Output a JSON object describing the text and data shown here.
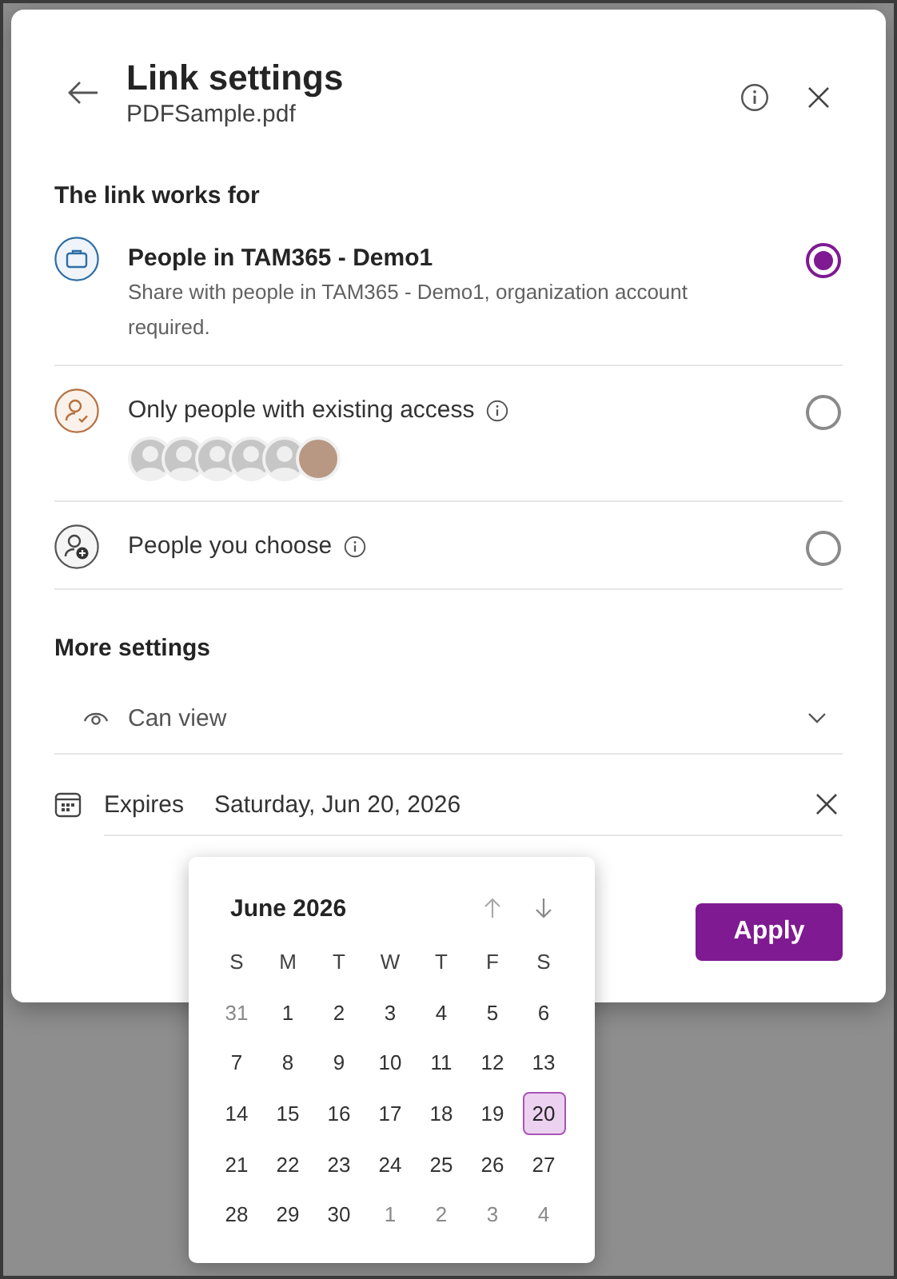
{
  "dialog": {
    "title": "Link settings",
    "file_name": "PDFSample.pdf",
    "section_title": "The link works for",
    "options": [
      {
        "kind": "organization",
        "title": "People in TAM365 - Demo1",
        "description": "Share with people in TAM365 - Demo1, organization account required.",
        "info": false,
        "selected": true
      },
      {
        "kind": "existing",
        "title": "Only people with existing access",
        "info": true,
        "selected": false,
        "avatars": [
          {
            "kind": "placeholder"
          },
          {
            "kind": "placeholder"
          },
          {
            "kind": "placeholder"
          },
          {
            "kind": "placeholder"
          },
          {
            "kind": "placeholder"
          },
          {
            "kind": "photo"
          }
        ]
      },
      {
        "kind": "choose",
        "title": "People you choose",
        "info": true,
        "selected": false
      }
    ],
    "more_settings_title": "More settings",
    "permission": "Can view",
    "expires_label": "Expires",
    "expires_date": "Saturday, Jun 20, 2026",
    "apply_button": "Apply"
  },
  "date_picker": {
    "month": "June 2026",
    "weekdays": [
      "S",
      "M",
      "T",
      "W",
      "T",
      "F",
      "S"
    ],
    "days": [
      {
        "day": "31",
        "outside": true,
        "selected": false
      },
      {
        "day": "1",
        "outside": false,
        "selected": false
      },
      {
        "day": "2",
        "outside": false,
        "selected": false
      },
      {
        "day": "3",
        "outside": false,
        "selected": false
      },
      {
        "day": "4",
        "outside": false,
        "selected": false
      },
      {
        "day": "5",
        "outside": false,
        "selected": false
      },
      {
        "day": "6",
        "outside": false,
        "selected": false
      },
      {
        "day": "7",
        "outside": false,
        "selected": false
      },
      {
        "day": "8",
        "outside": false,
        "selected": false
      },
      {
        "day": "9",
        "outside": false,
        "selected": false
      },
      {
        "day": "10",
        "outside": false,
        "selected": false
      },
      {
        "day": "11",
        "outside": false,
        "selected": false
      },
      {
        "day": "12",
        "outside": false,
        "selected": false
      },
      {
        "day": "13",
        "outside": false,
        "selected": false
      },
      {
        "day": "14",
        "outside": false,
        "selected": false
      },
      {
        "day": "15",
        "outside": false,
        "selected": false
      },
      {
        "day": "16",
        "outside": false,
        "selected": false
      },
      {
        "day": "17",
        "outside": false,
        "selected": false
      },
      {
        "day": "18",
        "outside": false,
        "selected": false
      },
      {
        "day": "19",
        "outside": false,
        "selected": false
      },
      {
        "day": "20",
        "outside": false,
        "selected": true
      },
      {
        "day": "21",
        "outside": false,
        "selected": false
      },
      {
        "day": "22",
        "outside": false,
        "selected": false
      },
      {
        "day": "23",
        "outside": false,
        "selected": false
      },
      {
        "day": "24",
        "outside": false,
        "selected": false
      },
      {
        "day": "25",
        "outside": false,
        "selected": false
      },
      {
        "day": "26",
        "outside": false,
        "selected": false
      },
      {
        "day": "27",
        "outside": false,
        "selected": false
      },
      {
        "day": "28",
        "outside": false,
        "selected": false
      },
      {
        "day": "29",
        "outside": false,
        "selected": false
      },
      {
        "day": "30",
        "outside": false,
        "selected": false
      },
      {
        "day": "1",
        "outside": true,
        "selected": false
      },
      {
        "day": "2",
        "outside": true,
        "selected": false
      },
      {
        "day": "3",
        "outside": true,
        "selected": false
      },
      {
        "day": "4",
        "outside": true,
        "selected": false
      }
    ]
  }
}
